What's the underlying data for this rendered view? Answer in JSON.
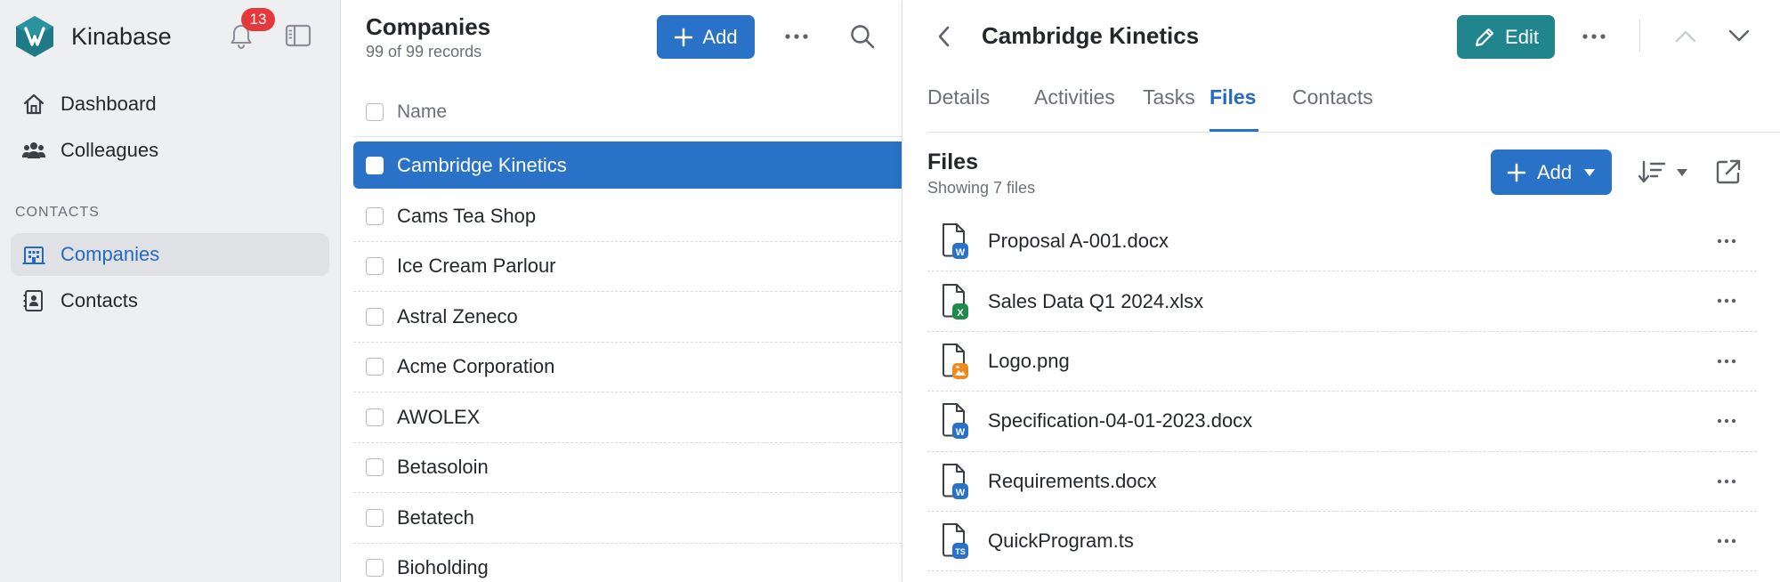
{
  "sidebar": {
    "brand": "Kinabase",
    "notifications_count": "13",
    "nav": [
      {
        "label": "Dashboard",
        "icon": "home-icon"
      },
      {
        "label": "Colleagues",
        "icon": "users-icon"
      }
    ],
    "section_label": "CONTACTS",
    "section_nav": [
      {
        "label": "Companies",
        "icon": "building-icon",
        "active": true
      },
      {
        "label": "Contacts",
        "icon": "contact-card-icon",
        "active": false
      }
    ]
  },
  "list": {
    "title": "Companies",
    "subtitle": "99 of 99 records",
    "add_label": "Add",
    "column_header": "Name",
    "rows": [
      {
        "name": "Cambridge Kinetics",
        "selected": true
      },
      {
        "name": "Cams Tea Shop",
        "selected": false
      },
      {
        "name": "Ice Cream Parlour",
        "selected": false
      },
      {
        "name": "Astral Zeneco",
        "selected": false
      },
      {
        "name": "Acme Corporation",
        "selected": false
      },
      {
        "name": "AWOLEX",
        "selected": false
      },
      {
        "name": "Betasoloin",
        "selected": false
      },
      {
        "name": "Betatech",
        "selected": false
      },
      {
        "name": "Bioholding",
        "selected": false
      }
    ]
  },
  "detail": {
    "title": "Cambridge Kinetics",
    "edit_label": "Edit",
    "tabs": [
      {
        "label": "Details",
        "active": false
      },
      {
        "label": "Activities",
        "active": false
      },
      {
        "label": "Tasks",
        "active": false
      },
      {
        "label": "Files",
        "active": true
      },
      {
        "label": "Contacts",
        "active": false
      }
    ],
    "files_title": "Files",
    "files_subtitle": "Showing 7 files",
    "add_label": "Add",
    "files": [
      {
        "name": "Proposal A-001.docx",
        "type": "word",
        "badge": "W",
        "color": "#2a72c8"
      },
      {
        "name": "Sales Data Q1 2024.xlsx",
        "type": "excel",
        "badge": "X",
        "color": "#1f8a4c"
      },
      {
        "name": "Logo.png",
        "type": "image",
        "badge": "",
        "color": "#ef8a1f"
      },
      {
        "name": "Specification-04-01-2023.docx",
        "type": "word",
        "badge": "W",
        "color": "#2a72c8"
      },
      {
        "name": "Requirements.docx",
        "type": "word",
        "badge": "W",
        "color": "#2a72c8"
      },
      {
        "name": "QuickProgram.ts",
        "type": "typescript",
        "badge": "TS",
        "color": "#2a72c8"
      }
    ]
  },
  "colors": {
    "primary": "#2a72c8",
    "teal": "#20858d",
    "badge_red": "#e5383b",
    "sidebar_bg": "#eeeff1"
  }
}
